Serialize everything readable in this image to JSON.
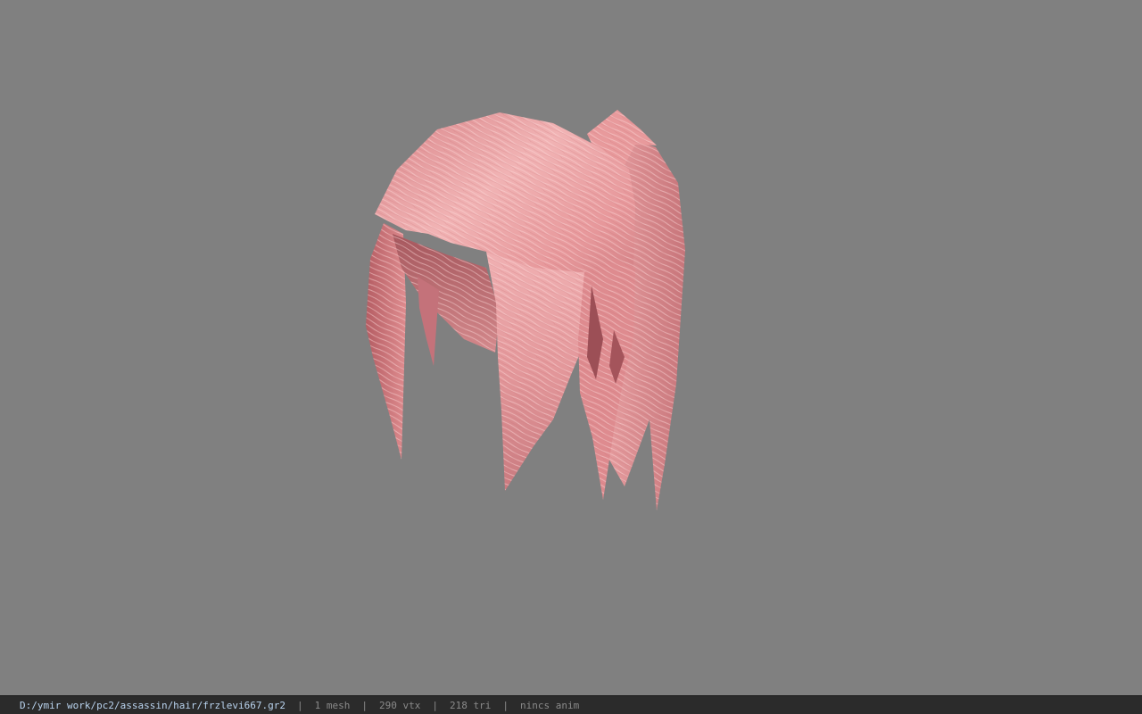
{
  "viewport": {
    "background_color": "#808080",
    "model": "pink-hair-mesh",
    "hair_colors": {
      "base": "#e98f92",
      "light": "#f6c4c4",
      "shadow": "#b85e63",
      "dark": "#8f4a50"
    }
  },
  "status_bar": {
    "file_path": "D:/ymir work/pc2/assassin/hair/frzlevi667.gr2",
    "mesh_count": "1 mesh",
    "vertex_count": "290 vtx",
    "triangle_count": "218 tri",
    "anim": "nincs anim",
    "separator": "|",
    "path_color": "#b9d3ee",
    "text_color": "#8a8a8a"
  }
}
